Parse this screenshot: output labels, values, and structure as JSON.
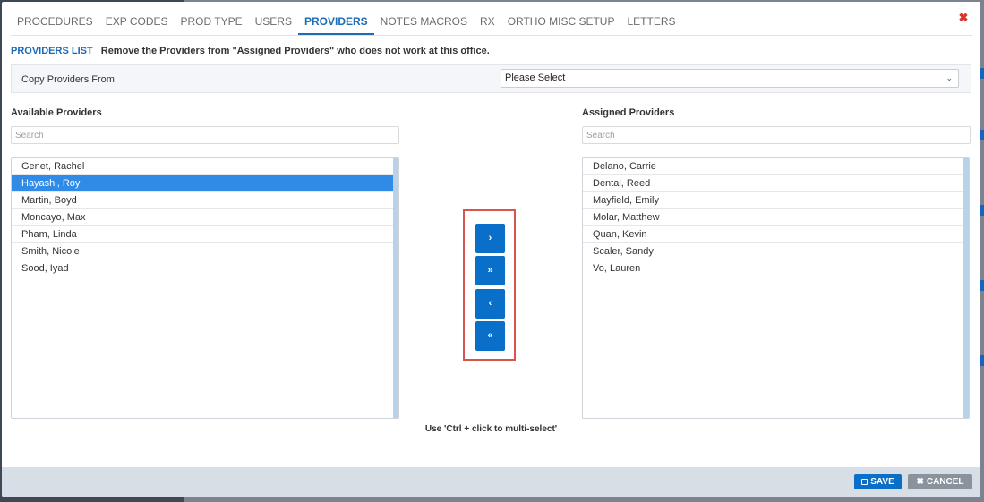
{
  "tabs": [
    {
      "label": "PROCEDURES",
      "active": false
    },
    {
      "label": "EXP CODES",
      "active": false
    },
    {
      "label": "PROD TYPE",
      "active": false
    },
    {
      "label": "USERS",
      "active": false
    },
    {
      "label": "PROVIDERS",
      "active": true
    },
    {
      "label": "NOTES MACROS",
      "active": false
    },
    {
      "label": "RX",
      "active": false
    },
    {
      "label": "ORTHO MISC SETUP",
      "active": false
    },
    {
      "label": "LETTERS",
      "active": false
    }
  ],
  "close_glyph": "✖",
  "providers_list": {
    "title": "PROVIDERS LIST",
    "description": "Remove the Providers from \"Assigned Providers\" who does not work at this office."
  },
  "copy_from": {
    "label": "Copy Providers From",
    "selected": "Please Select",
    "chevron": "⌄"
  },
  "available": {
    "label": "Available Providers",
    "search_placeholder": "Search",
    "items": [
      "Genet, Rachel",
      "Hayashi, Roy",
      "Martin, Boyd",
      "Moncayo, Max",
      "Pham, Linda",
      "Smith, Nicole",
      "Sood, Iyad"
    ],
    "selected_index": 1
  },
  "assigned": {
    "label": "Assigned Providers",
    "search_placeholder": "Search",
    "items": [
      "Delano, Carrie",
      "Dental, Reed",
      "Mayfield, Emily",
      "Molar, Matthew",
      "Quan, Kevin",
      "Scaler, Sandy",
      "Vo, Lauren"
    ]
  },
  "move_buttons": {
    "move_right": "›",
    "move_all_right": "»",
    "move_left": "‹",
    "move_all_left": "«"
  },
  "hint": "Use 'Ctrl + click to multi-select'",
  "footer": {
    "save_label": "SAVE",
    "cancel_label": "CANCEL",
    "cancel_glyph": "✖"
  },
  "colors": {
    "accent": "#0a6fc9",
    "selected_row": "#2f8be6",
    "highlight_border": "#d9534f",
    "close": "#d9342b"
  }
}
